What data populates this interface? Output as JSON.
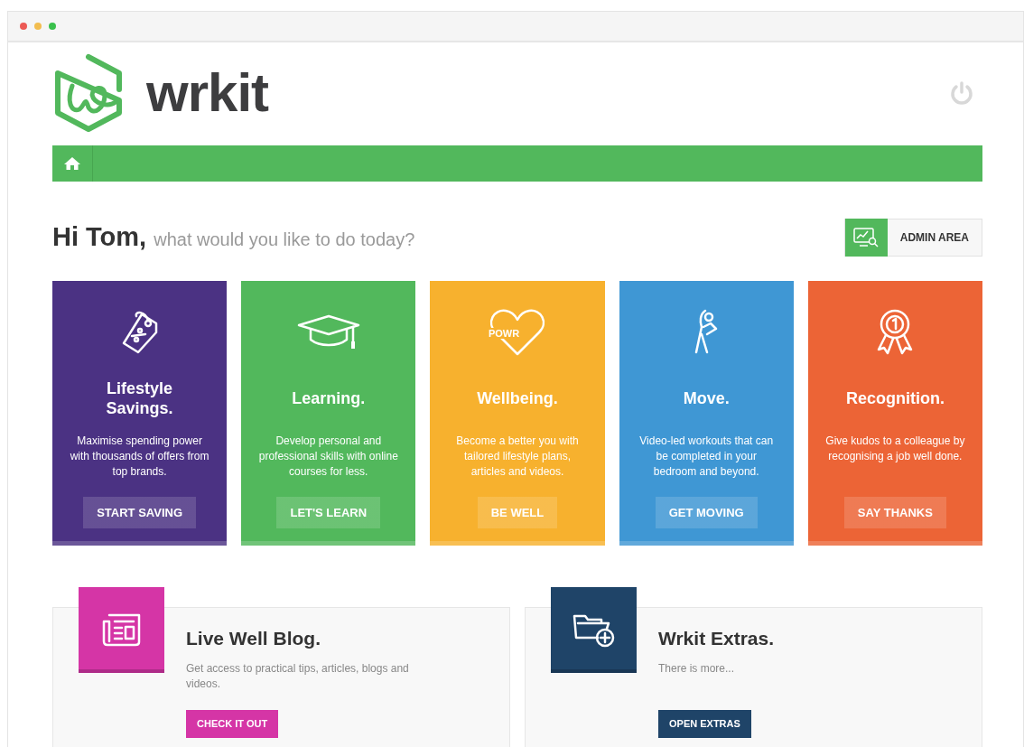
{
  "logo": {
    "text": "wrkit"
  },
  "greeting": {
    "name": "Hi Tom,",
    "prompt": "what would you like to do today?"
  },
  "admin_button": {
    "label": "ADMIN AREA"
  },
  "tiles": [
    {
      "title": "Lifestyle Savings.",
      "text": "Maximise spending power with thousands of offers from top brands.",
      "button": "START SAVING",
      "color": "#4b3283"
    },
    {
      "title": "Learning.",
      "text": "Develop personal and professional skills with online courses for less.",
      "button": "LET'S LEARN",
      "color": "#52b85c"
    },
    {
      "title": "Wellbeing.",
      "text": "Become a better you with tailored lifestyle plans, articles and videos.",
      "button": "BE WELL",
      "color": "#f7b12e",
      "icon_text": "POWR"
    },
    {
      "title": "Move.",
      "text": "Video-led workouts that can be completed in your bedroom and beyond.",
      "button": "GET MOVING",
      "color": "#3f97d4"
    },
    {
      "title": "Recognition.",
      "text": "Give kudos to a colleague by recognising a job well done.",
      "button": "SAY THANKS",
      "color": "#ec6436"
    }
  ],
  "promos": [
    {
      "title": "Live Well Blog.",
      "text": "Get access to practical tips, articles, blogs and videos.",
      "button": "CHECK IT OUT",
      "color": "#d535a6"
    },
    {
      "title": "Wrkit Extras.",
      "text": "There is more...",
      "button": "OPEN EXTRAS",
      "color": "#1f4468"
    }
  ]
}
